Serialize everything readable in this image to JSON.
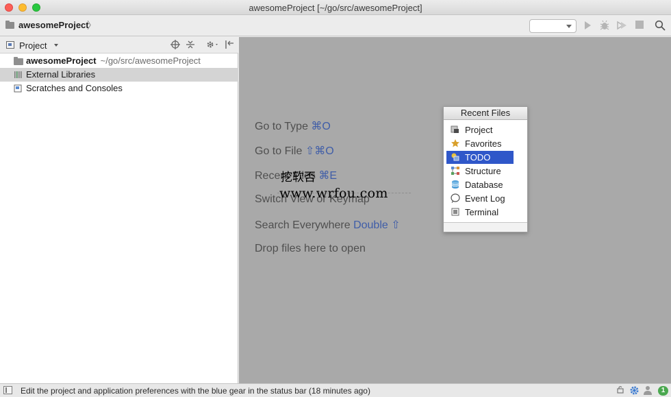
{
  "window": {
    "title": "awesomeProject [~/go/src/awesomeProject]"
  },
  "navbar": {
    "project_name": "awesomeProject",
    "chevron": "〉",
    "run_config_value": ""
  },
  "project_panel": {
    "title": "Project",
    "tree": [
      {
        "label": "awesomeProject",
        "sublabel": "~/go/src/awesomeProject",
        "icon": "folder-icon",
        "bold": true
      },
      {
        "label": "External Libraries",
        "icon": "library-icon",
        "selected": true
      },
      {
        "label": "Scratches and Consoles",
        "icon": "scratches-icon"
      }
    ]
  },
  "editor_hints": [
    {
      "text": "Go to Type ",
      "shortcut": "⌘O"
    },
    {
      "text": "Go to File ",
      "shortcut": "⇧⌘O"
    },
    {
      "text": "Recent Files ",
      "shortcut": "⌘E"
    },
    {
      "text": "Switch View or Keymap",
      "shortcut": ""
    },
    {
      "text": "Search Everywhere ",
      "shortcut": "Double ⇧"
    },
    {
      "text": "Drop files here to open",
      "shortcut": ""
    }
  ],
  "watermark": {
    "line1": "挖软否",
    "line2": "www.wrfou.com"
  },
  "recent_files_popup": {
    "title": "Recent Files",
    "items": [
      {
        "label": "Project",
        "icon": "project-icon"
      },
      {
        "label": "Favorites",
        "icon": "star-icon"
      },
      {
        "label": "TODO",
        "icon": "todo-icon",
        "selected": true
      },
      {
        "label": "Structure",
        "icon": "structure-icon"
      },
      {
        "label": "Database",
        "icon": "database-icon"
      },
      {
        "label": "Event Log",
        "icon": "event-log-icon"
      },
      {
        "label": "Terminal",
        "icon": "terminal-icon"
      }
    ]
  },
  "statusbar": {
    "message": "Edit the project and application preferences with the blue gear in the status bar (18 minutes ago)",
    "notification_count": "1"
  },
  "colors": {
    "editor_bg": "#a9a9a9",
    "shortcut_blue": "#3f5da8",
    "selection_blue": "#2f57c9",
    "tree_selection": "#d4d4d4",
    "gear_blue": "#3c7bd1",
    "badge_green": "#4aa84f"
  }
}
